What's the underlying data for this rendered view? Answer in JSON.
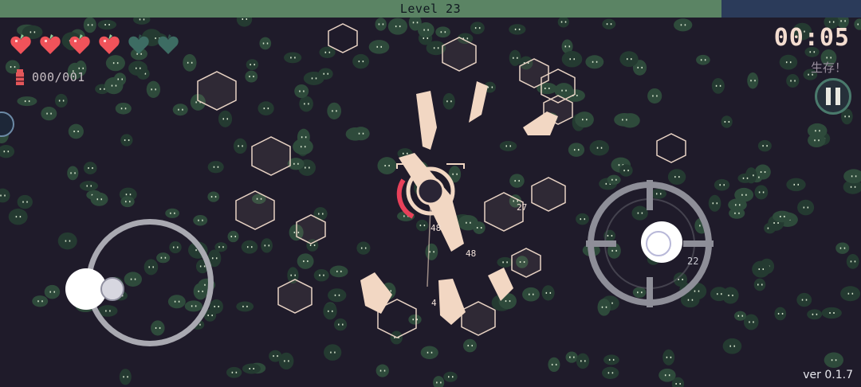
{
  "hud": {
    "level_label": "Level",
    "level_value": "23",
    "level_text": "Level   23",
    "xp_progress": 0.838,
    "timer": "00:05",
    "status": "生存！",
    "ammo": "000/001",
    "version": "ver 0.1.7"
  },
  "health": {
    "hearts": [
      {
        "state": "full"
      },
      {
        "state": "full"
      },
      {
        "state": "full"
      },
      {
        "state": "full"
      },
      {
        "state": "empty"
      },
      {
        "state": "empty"
      }
    ]
  },
  "floating_numbers": [
    "48",
    "48",
    "4",
    "27",
    "22"
  ],
  "icons": {
    "heart": "heart-icon",
    "ammo": "bullet-icon",
    "pause": "pause-icon"
  },
  "colors": {
    "background": "#1f1b2a",
    "xp_fill": "#5b8464",
    "xp_empty": "#2b3b5a",
    "heart_full": "#f0535a",
    "heart_empty": "#3d6c63",
    "ui_cream": "#f4ddd0",
    "foliage": "#3a5b47"
  }
}
